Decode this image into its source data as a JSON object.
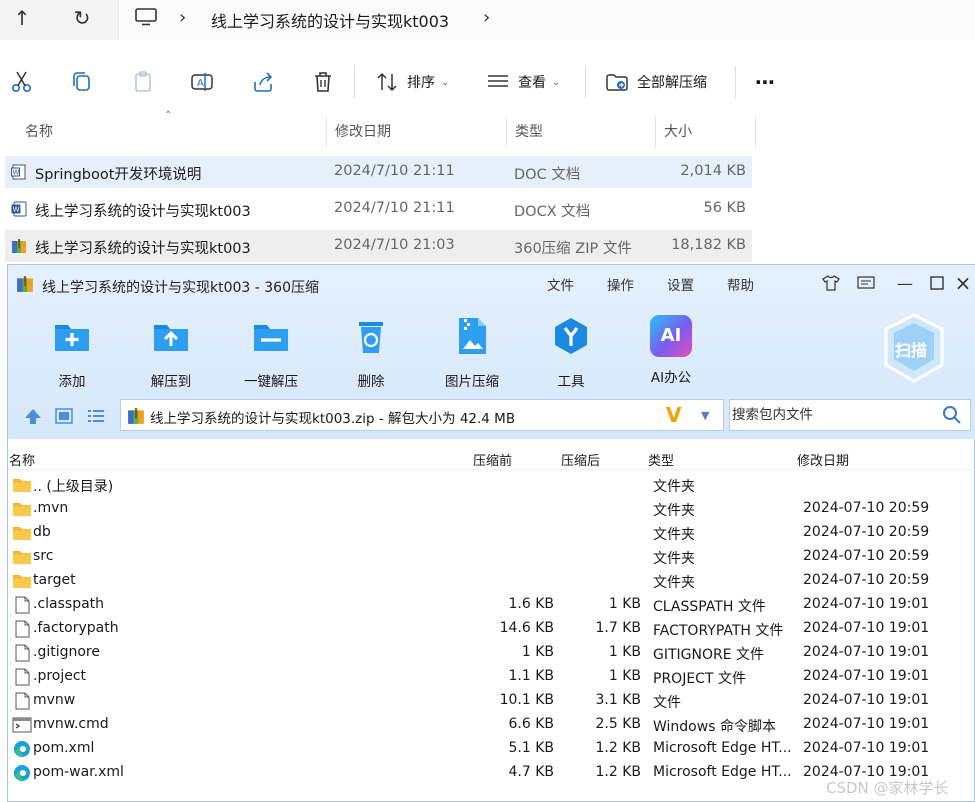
{
  "explorer": {
    "breadcrumb": "线上学习系统的设计与实现kt003",
    "commands": {
      "sort": "排序",
      "view": "查看",
      "extract_all": "全部解压缩"
    },
    "columns": {
      "name": "名称",
      "modified": "修改日期",
      "type": "类型",
      "size": "大小"
    },
    "files": [
      {
        "name": "Springboot开发环境说明",
        "modified": "2024/7/10 21:11",
        "type": "DOC 文档",
        "size": "2,014 KB",
        "icon": "word-doc-icon"
      },
      {
        "name": "线上学习系统的设计与实现kt003",
        "modified": "2024/7/10 21:11",
        "type": "DOCX 文档",
        "size": "56 KB",
        "icon": "word-docx-icon"
      },
      {
        "name": "线上学习系统的设计与实现kt003",
        "modified": "2024/7/10 21:03",
        "type": "360压缩 ZIP 文件",
        "size": "18,182 KB",
        "icon": "zip-archive-icon"
      }
    ]
  },
  "zip": {
    "title": "线上学习系统的设计与实现kt003 - 360压缩",
    "menu": {
      "file": "文件",
      "operate": "操作",
      "settings": "设置",
      "help": "帮助"
    },
    "tools": {
      "add": "添加",
      "extract_to": "解压到",
      "one_click": "一键解压",
      "delete": "删除",
      "image_compress": "图片压缩",
      "tools": "工具",
      "ai_office": "AI办公"
    },
    "ai_badge": "AI",
    "scan": "扫描",
    "path": "线上学习系统的设计与实现kt003.zip - 解包大小为 42.4 MB",
    "search_placeholder": "搜索包内文件",
    "columns": {
      "name": "名称",
      "before": "压缩前",
      "after": "压缩后",
      "type": "类型",
      "modified": "修改日期"
    },
    "rows": [
      {
        "name": ".. (上级目录)",
        "before": "",
        "after": "",
        "type": "文件夹",
        "modified": "",
        "icon": "folder-icon"
      },
      {
        "name": ".mvn",
        "before": "",
        "after": "",
        "type": "文件夹",
        "modified": "2024-07-10 20:59",
        "icon": "folder-icon"
      },
      {
        "name": "db",
        "before": "",
        "after": "",
        "type": "文件夹",
        "modified": "2024-07-10 20:59",
        "icon": "folder-icon"
      },
      {
        "name": "src",
        "before": "",
        "after": "",
        "type": "文件夹",
        "modified": "2024-07-10 20:59",
        "icon": "folder-icon"
      },
      {
        "name": "target",
        "before": "",
        "after": "",
        "type": "文件夹",
        "modified": "2024-07-10 20:59",
        "icon": "folder-icon"
      },
      {
        "name": ".classpath",
        "before": "1.6 KB",
        "after": "1 KB",
        "type": "CLASSPATH 文件",
        "modified": "2024-07-10 19:01",
        "icon": "file-icon"
      },
      {
        "name": ".factorypath",
        "before": "14.6 KB",
        "after": "1.7 KB",
        "type": "FACTORYPATH 文件",
        "modified": "2024-07-10 19:01",
        "icon": "file-icon"
      },
      {
        "name": ".gitignore",
        "before": "1 KB",
        "after": "1 KB",
        "type": "GITIGNORE 文件",
        "modified": "2024-07-10 19:01",
        "icon": "file-icon"
      },
      {
        "name": ".project",
        "before": "1.1 KB",
        "after": "1 KB",
        "type": "PROJECT 文件",
        "modified": "2024-07-10 19:01",
        "icon": "file-icon"
      },
      {
        "name": "mvnw",
        "before": "10.1 KB",
        "after": "3.1 KB",
        "type": "文件",
        "modified": "2024-07-10 19:01",
        "icon": "file-icon"
      },
      {
        "name": "mvnw.cmd",
        "before": "6.6 KB",
        "after": "2.5 KB",
        "type": "Windows 命令脚本",
        "modified": "2024-07-10 19:01",
        "icon": "cmd-script-icon"
      },
      {
        "name": "pom.xml",
        "before": "5.1 KB",
        "after": "1.2 KB",
        "type": "Microsoft Edge HT...",
        "modified": "2024-07-10 19:01",
        "icon": "edge-icon"
      },
      {
        "name": "pom-war.xml",
        "before": "4.7 KB",
        "after": "1.2 KB",
        "type": "Microsoft Edge HT...",
        "modified": "2024-07-10 19:01",
        "icon": "edge-icon"
      }
    ]
  },
  "watermark": "CSDN @家林学长"
}
